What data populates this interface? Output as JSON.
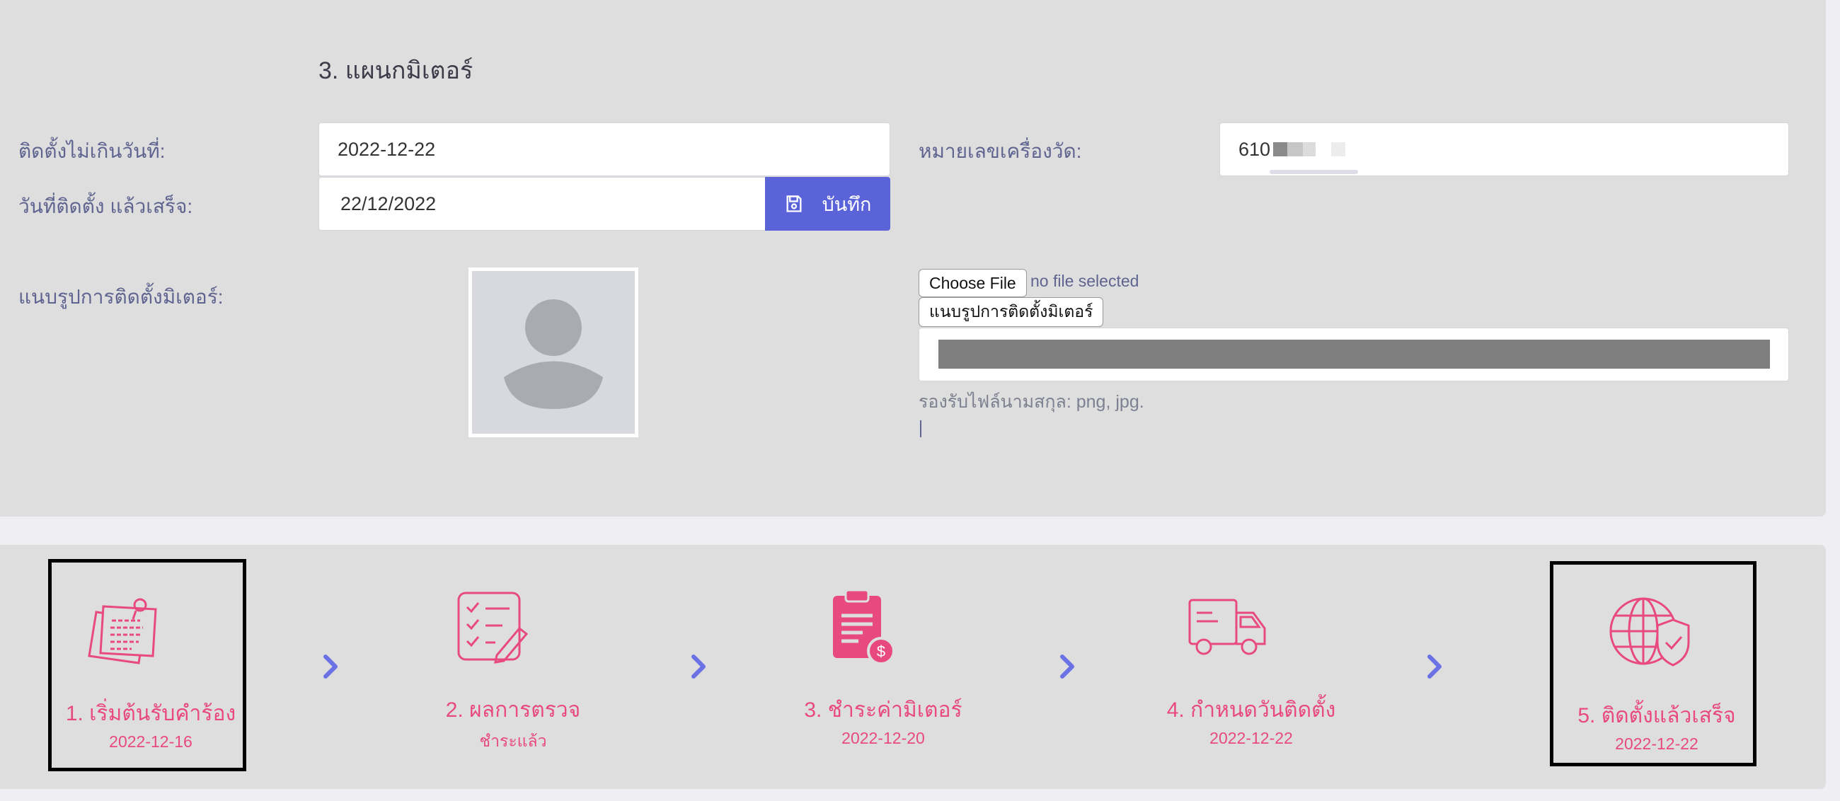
{
  "section": {
    "title": "3. แผนกมิเตอร์"
  },
  "form": {
    "install_deadline_label": "ติดตั้งไม่เกินวันที่:",
    "install_deadline_value": "2022-12-22",
    "meter_number_label": "หมายเลขเครื่องวัด:",
    "meter_number_value": "610",
    "install_done_label": "วันที่ติดตั้ง แล้วเสร็จ:",
    "install_done_value": "22/12/2022",
    "save_label": "บันทึก",
    "attach_label": "แนบรูปการติดตั้งมิเตอร์:",
    "choose_file_label": "Choose File",
    "file_status": "no file selected",
    "upload_button_label": "แนบรูปการติดตั้งมิเตอร์",
    "upload_progress": 1.0,
    "hint": "รองรับไฟล์นามสกุล: png, jpg."
  },
  "steps": [
    {
      "title": "1. เริ่มต้นรับคำร้อง",
      "sub": "2022-12-16",
      "icon": "documents-icon"
    },
    {
      "title": "2. ผลการตรวจ",
      "sub": "ชำระแล้ว",
      "icon": "checklist-icon"
    },
    {
      "title": "3. ชำระค่ามิเตอร์",
      "sub": "2022-12-20",
      "icon": "clipboard-dollar-icon"
    },
    {
      "title": "4. กำหนดวันติดตั้ง",
      "sub": "2022-12-22",
      "icon": "truck-icon"
    },
    {
      "title": "5. ติดตั้งแล้วเสร็จ",
      "sub": "2022-12-22",
      "icon": "globe-shield-icon"
    }
  ],
  "colors": {
    "accent": "#5a63d8",
    "step_pink": "#e84a7f",
    "chevron": "#6b72e6"
  }
}
